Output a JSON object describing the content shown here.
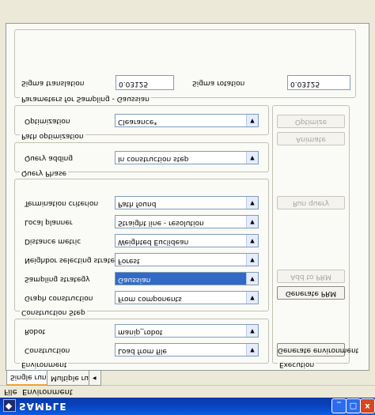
{
  "window": {
    "title": "SAMPLE",
    "minimize": "_",
    "maximize": "□",
    "close": "x"
  },
  "menu": {
    "items": [
      "File",
      "Environment"
    ]
  },
  "tabs": [
    {
      "label": "Single run",
      "active": true
    },
    {
      "label": "Multiple runs",
      "active": false
    }
  ],
  "tab_scroll": "◂",
  "environment": {
    "title": "Environment",
    "construction_label": "Construction",
    "construction_value": "Load from file",
    "robot_label": "Robot",
    "robot_value": "manip_robot"
  },
  "construction_step": {
    "title": "Construction Step",
    "graph_label": "Graph construction",
    "graph_value": "From components",
    "sampling_label": "Sampling strategy",
    "sampling_value": "Gaussian",
    "neighbor_label": "Neighbor selecting strategy",
    "neighbor_value": "Forest",
    "distance_label": "Distance metric",
    "distance_value": "Weighted Euclidean",
    "planner_label": "Local planner",
    "planner_value": "Straight line - resolution",
    "termination_label": "Termination criterion",
    "termination_value": "Path found"
  },
  "query_phase": {
    "title": "Query Phase",
    "adding_label": "Query adding",
    "adding_value": "In construction step"
  },
  "path_optimization": {
    "title": "Path optimization",
    "optimization_label": "Optimization",
    "optimization_value": "Clearance*"
  },
  "gaussian": {
    "title": "Parameters for Sampling - Gaussian",
    "translation_label": "Sigma translation",
    "translation_value": "0.03125",
    "rotation_label": "Sigma rotation",
    "rotation_value": "0.03125"
  },
  "execution": {
    "title": "Execution",
    "generate_env": "Generate environment",
    "generate_prm": "Generate PRM",
    "add_to_prm": "Add to PRM",
    "run_query": "Run query",
    "animate": "Animate",
    "optimize": "Optimize"
  },
  "combo_arrow": "▼"
}
